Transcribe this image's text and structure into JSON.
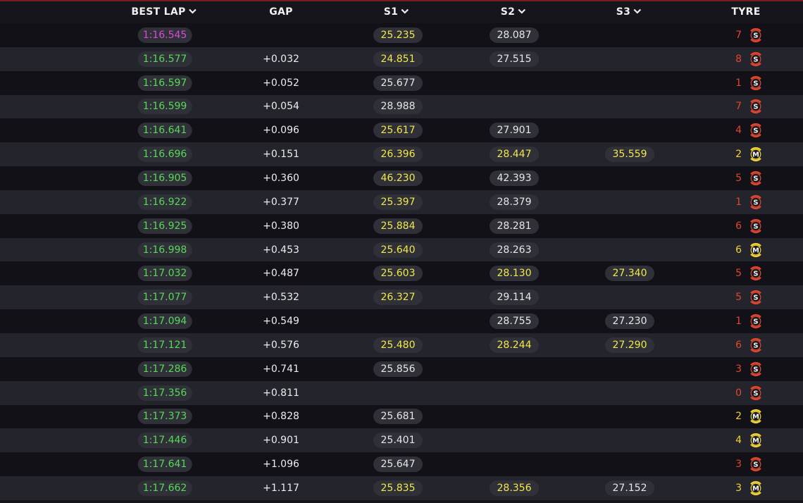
{
  "header": {
    "best_lap": "BEST LAP",
    "gap": "GAP",
    "s1": "S1",
    "s2": "S2",
    "s3": "S3",
    "tyre": "TYRE"
  },
  "colors": {
    "purple": "#d94bd6",
    "green": "#57d957",
    "yellow": "#f2e84a",
    "white": "#e6e6e6",
    "soft": "#e0452f",
    "medium": "#f2d230"
  },
  "rows": [
    {
      "best_lap": "1:16.545",
      "lap_color": "purple",
      "gap": "",
      "s1": "25.235",
      "s1_color": "yellow",
      "s2": "28.087",
      "s2_color": "white",
      "s3": "",
      "s3_color": "white",
      "laps": "7",
      "tyre": "S"
    },
    {
      "best_lap": "1:16.577",
      "lap_color": "green",
      "gap": "+0.032",
      "s1": "24.851",
      "s1_color": "yellow",
      "s2": "27.515",
      "s2_color": "white",
      "s3": "",
      "s3_color": "white",
      "laps": "8",
      "tyre": "S"
    },
    {
      "best_lap": "1:16.597",
      "lap_color": "green",
      "gap": "+0.052",
      "s1": "25.677",
      "s1_color": "white",
      "s2": "",
      "s2_color": "white",
      "s3": "",
      "s3_color": "white",
      "laps": "1",
      "tyre": "S"
    },
    {
      "best_lap": "1:16.599",
      "lap_color": "green",
      "gap": "+0.054",
      "s1": "28.988",
      "s1_color": "white",
      "s2": "",
      "s2_color": "white",
      "s3": "",
      "s3_color": "white",
      "laps": "7",
      "tyre": "S"
    },
    {
      "best_lap": "1:16.641",
      "lap_color": "green",
      "gap": "+0.096",
      "s1": "25.617",
      "s1_color": "yellow",
      "s2": "27.901",
      "s2_color": "white",
      "s3": "",
      "s3_color": "white",
      "laps": "4",
      "tyre": "S"
    },
    {
      "best_lap": "1:16.696",
      "lap_color": "green",
      "gap": "+0.151",
      "s1": "26.396",
      "s1_color": "yellow",
      "s2": "28.447",
      "s2_color": "yellow",
      "s3": "35.559",
      "s3_color": "yellow",
      "laps": "2",
      "tyre": "M"
    },
    {
      "best_lap": "1:16.905",
      "lap_color": "green",
      "gap": "+0.360",
      "s1": "46.230",
      "s1_color": "yellow",
      "s2": "42.393",
      "s2_color": "white",
      "s3": "",
      "s3_color": "white",
      "laps": "5",
      "tyre": "S"
    },
    {
      "best_lap": "1:16.922",
      "lap_color": "green",
      "gap": "+0.377",
      "s1": "25.397",
      "s1_color": "yellow",
      "s2": "28.379",
      "s2_color": "white",
      "s3": "",
      "s3_color": "white",
      "laps": "1",
      "tyre": "S"
    },
    {
      "best_lap": "1:16.925",
      "lap_color": "green",
      "gap": "+0.380",
      "s1": "25.884",
      "s1_color": "yellow",
      "s2": "28.281",
      "s2_color": "white",
      "s3": "",
      "s3_color": "white",
      "laps": "6",
      "tyre": "S"
    },
    {
      "best_lap": "1:16.998",
      "lap_color": "green",
      "gap": "+0.453",
      "s1": "25.640",
      "s1_color": "yellow",
      "s2": "28.263",
      "s2_color": "white",
      "s3": "",
      "s3_color": "white",
      "laps": "6",
      "tyre": "M"
    },
    {
      "best_lap": "1:17.032",
      "lap_color": "green",
      "gap": "+0.487",
      "s1": "25.603",
      "s1_color": "yellow",
      "s2": "28.130",
      "s2_color": "yellow",
      "s3": "27.340",
      "s3_color": "yellow",
      "laps": "5",
      "tyre": "S"
    },
    {
      "best_lap": "1:17.077",
      "lap_color": "green",
      "gap": "+0.532",
      "s1": "26.327",
      "s1_color": "yellow",
      "s2": "29.114",
      "s2_color": "white",
      "s3": "",
      "s3_color": "white",
      "laps": "5",
      "tyre": "S"
    },
    {
      "best_lap": "1:17.094",
      "lap_color": "green",
      "gap": "+0.549",
      "s1": "",
      "s1_color": "white",
      "s2": "28.755",
      "s2_color": "white",
      "s3": "27.230",
      "s3_color": "white",
      "laps": "1",
      "tyre": "S"
    },
    {
      "best_lap": "1:17.121",
      "lap_color": "green",
      "gap": "+0.576",
      "s1": "25.480",
      "s1_color": "yellow",
      "s2": "28.244",
      "s2_color": "yellow",
      "s3": "27.290",
      "s3_color": "yellow",
      "laps": "6",
      "tyre": "S"
    },
    {
      "best_lap": "1:17.286",
      "lap_color": "green",
      "gap": "+0.741",
      "s1": "25.856",
      "s1_color": "white",
      "s2": "",
      "s2_color": "white",
      "s3": "",
      "s3_color": "white",
      "laps": "3",
      "tyre": "S"
    },
    {
      "best_lap": "1:17.356",
      "lap_color": "green",
      "gap": "+0.811",
      "s1": "",
      "s1_color": "white",
      "s2": "",
      "s2_color": "white",
      "s3": "",
      "s3_color": "white",
      "laps": "0",
      "tyre": "S"
    },
    {
      "best_lap": "1:17.373",
      "lap_color": "green",
      "gap": "+0.828",
      "s1": "25.681",
      "s1_color": "white",
      "s2": "",
      "s2_color": "white",
      "s3": "",
      "s3_color": "white",
      "laps": "2",
      "tyre": "M"
    },
    {
      "best_lap": "1:17.446",
      "lap_color": "green",
      "gap": "+0.901",
      "s1": "25.401",
      "s1_color": "white",
      "s2": "",
      "s2_color": "white",
      "s3": "",
      "s3_color": "white",
      "laps": "4",
      "tyre": "M"
    },
    {
      "best_lap": "1:17.641",
      "lap_color": "green",
      "gap": "+1.096",
      "s1": "25.647",
      "s1_color": "white",
      "s2": "",
      "s2_color": "white",
      "s3": "",
      "s3_color": "white",
      "laps": "3",
      "tyre": "S"
    },
    {
      "best_lap": "1:17.662",
      "lap_color": "green",
      "gap": "+1.117",
      "s1": "25.835",
      "s1_color": "yellow",
      "s2": "28.356",
      "s2_color": "yellow",
      "s3": "27.152",
      "s3_color": "white",
      "laps": "3",
      "tyre": "M"
    }
  ]
}
